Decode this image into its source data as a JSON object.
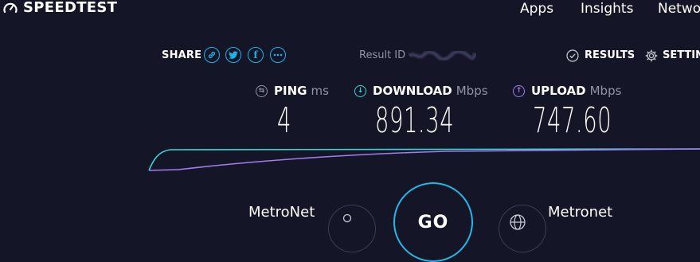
{
  "header": {
    "logo_text": "SPEEDTEST",
    "nav": [
      "Apps",
      "Insights",
      "Netwo"
    ]
  },
  "share": {
    "label": "SHARE",
    "buttons": [
      "link-icon",
      "twitter-icon",
      "facebook-icon",
      "more-icon"
    ]
  },
  "result": {
    "label": "Result ID"
  },
  "actions": {
    "results_label": "RESULTS",
    "settings_label": "SETTIN"
  },
  "metrics": {
    "ping": {
      "label": "PING",
      "unit": "ms",
      "value": "4"
    },
    "download": {
      "label": "DOWNLOAD",
      "unit": "Mbps",
      "value": "891.34"
    },
    "upload": {
      "label": "UPLOAD",
      "unit": "Mbps",
      "value": "747.60"
    }
  },
  "bottom": {
    "isp_left": "MetroNet",
    "isp_right": "Metronet",
    "go_label": "GO"
  },
  "colors": {
    "background": "#141526",
    "accent_blue": "#1ab3ea",
    "download_cyan": "#3ad6d6",
    "upload_purple": "#a37cf0",
    "muted": "#9094a6"
  }
}
